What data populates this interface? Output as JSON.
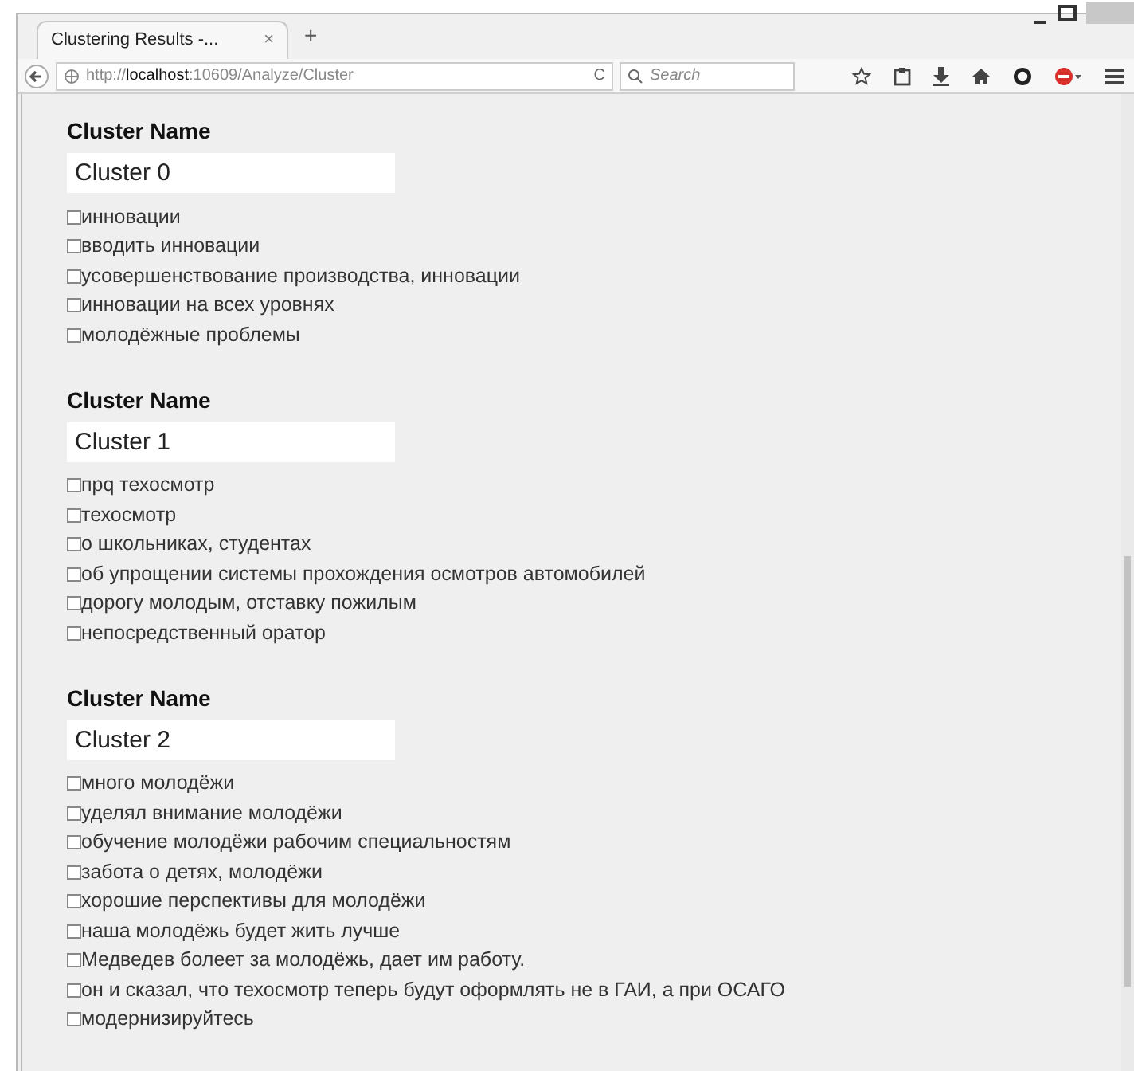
{
  "browser": {
    "tab_title": "Clustering Results -...",
    "tab_close": "×",
    "new_tab": "+",
    "url_prefix": "http://",
    "url_host": "localhost",
    "url_rest": ":10609/Analyze/Cluster",
    "reload": "C",
    "search_placeholder": "Search"
  },
  "clusters": [
    {
      "heading": "Cluster Name",
      "name": "Cluster 0",
      "items": [
        {
          "text": "инновации",
          "checked": false
        },
        {
          "text": "вводить инновации",
          "checked": false
        },
        {
          "text": "усовершенствование производства, инновации",
          "checked": false
        },
        {
          "text": "инновации на всех уровнях",
          "checked": false
        },
        {
          "text": "молодёжные проблемы",
          "checked": false
        }
      ]
    },
    {
      "heading": "Cluster Name",
      "name": "Cluster 1",
      "items": [
        {
          "text": "прq техосмотр",
          "checked": false
        },
        {
          "text": "техосмотр",
          "checked": false
        },
        {
          "text": "о школьниках, студентах",
          "checked": false
        },
        {
          "text": "об упрощении системы прохождения осмотров автомобилей",
          "checked": false
        },
        {
          "text": "дорогу молодым, отставку пожилым",
          "checked": false
        },
        {
          "text": "непосредственный оратор",
          "checked": false
        }
      ]
    },
    {
      "heading": "Cluster Name",
      "name": "Cluster 2",
      "items": [
        {
          "text": "много молодёжи",
          "checked": false
        },
        {
          "text": "уделял внимание молодёжи",
          "checked": false
        },
        {
          "text": "обучение молодёжи рабочим специальностям",
          "checked": false
        },
        {
          "text": "забота о детях, молодёжи",
          "checked": false
        },
        {
          "text": "хорошие перспективы для молодёжи",
          "checked": false
        },
        {
          "text": "наша молодёжь будет жить лучше",
          "checked": false
        },
        {
          "text": "Медведев болеет за молодёжь, дает им работу.",
          "checked": false
        },
        {
          "text": "он и сказал, что техосмотр теперь будут оформлять не в ГАИ, а при ОСАГО",
          "checked": false
        },
        {
          "text": "модернизируйтесь",
          "checked": false
        }
      ]
    }
  ]
}
